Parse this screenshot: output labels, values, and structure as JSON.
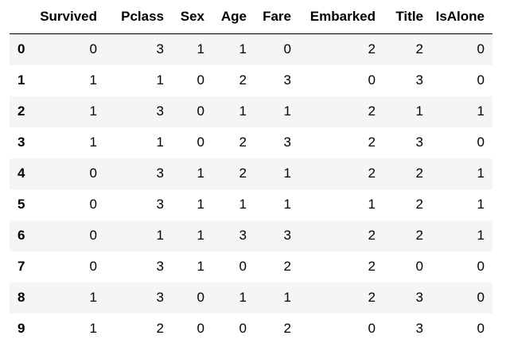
{
  "table": {
    "index_header": "",
    "columns": [
      "Survived",
      "Pclass",
      "Sex",
      "Age",
      "Fare",
      "Embarked",
      "Title",
      "IsAlone"
    ],
    "rows": [
      {
        "index": "0",
        "values": [
          "0",
          "3",
          "1",
          "1",
          "0",
          "2",
          "2",
          "0"
        ]
      },
      {
        "index": "1",
        "values": [
          "1",
          "1",
          "0",
          "2",
          "3",
          "0",
          "3",
          "0"
        ]
      },
      {
        "index": "2",
        "values": [
          "1",
          "3",
          "0",
          "1",
          "1",
          "2",
          "1",
          "1"
        ]
      },
      {
        "index": "3",
        "values": [
          "1",
          "1",
          "0",
          "2",
          "3",
          "2",
          "3",
          "0"
        ]
      },
      {
        "index": "4",
        "values": [
          "0",
          "3",
          "1",
          "2",
          "1",
          "2",
          "2",
          "1"
        ]
      },
      {
        "index": "5",
        "values": [
          "0",
          "3",
          "1",
          "1",
          "1",
          "1",
          "2",
          "1"
        ]
      },
      {
        "index": "6",
        "values": [
          "0",
          "1",
          "1",
          "3",
          "3",
          "2",
          "2",
          "1"
        ]
      },
      {
        "index": "7",
        "values": [
          "0",
          "3",
          "1",
          "0",
          "2",
          "2",
          "0",
          "0"
        ]
      },
      {
        "index": "8",
        "values": [
          "1",
          "3",
          "0",
          "1",
          "1",
          "2",
          "3",
          "0"
        ]
      },
      {
        "index": "9",
        "values": [
          "1",
          "2",
          "0",
          "0",
          "2",
          "0",
          "3",
          "0"
        ]
      }
    ]
  },
  "colors": {
    "text": "#000000",
    "stripe": "#f5f5f5",
    "background": "#ffffff",
    "header_rule": "#000000"
  }
}
